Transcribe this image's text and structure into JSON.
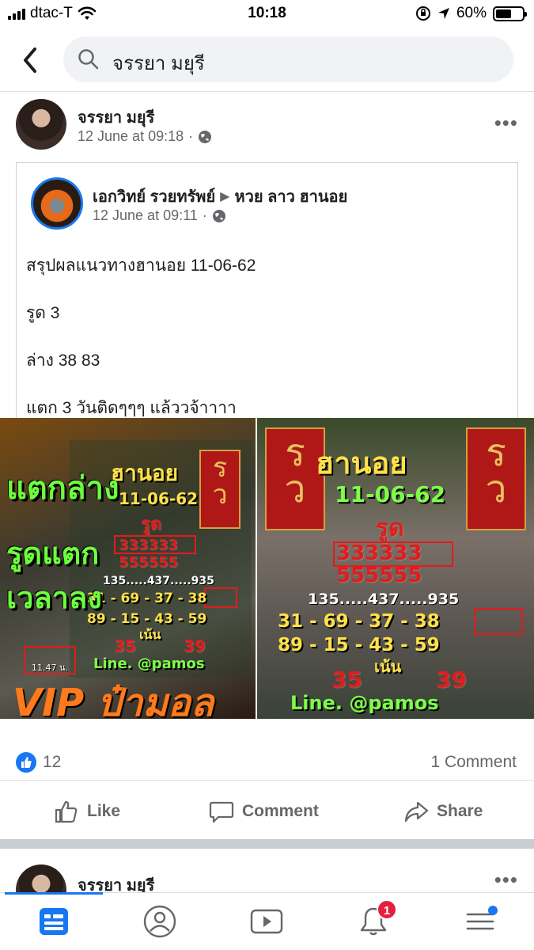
{
  "status_bar": {
    "carrier": "dtac-T",
    "time": "10:18",
    "battery_percent": "60%",
    "battery_level": 0.6
  },
  "search": {
    "query": "จรรยา มยุรี"
  },
  "post": {
    "author": "จรรยา มยุรี",
    "timestamp": "12 June at 09:18",
    "shared": {
      "page_name": "เอกวิทย์ รวยทรัพย์",
      "target_group": "หวย ลาว ฮานอย",
      "timestamp": "12 June at 09:11",
      "lines": [
        "สรุปผลแนวทางฮานอย 11-06-62",
        "รูด  3",
        "ล่าง  38  83",
        "แตก 3 วันติดๆๆๆ แล้ววจ้าาาา"
      ]
    },
    "images": {
      "left": {
        "tags": [
          "แตกล่าง",
          "รูดแตก",
          "เวลาลง"
        ],
        "time_note": "11.47 น.",
        "footer": "VIP ป๋ามอล",
        "title": "ฮานอย",
        "date": "11-06-62",
        "rood": "รูด",
        "row1": "333333",
        "row2": "555555",
        "row3": "135.....437.....935",
        "row4": "31 - 69 - 37 - 38",
        "row5": "89 - 15 - 43 - 59",
        "nen": "เน้น",
        "hl1": "35",
        "hl2": "39",
        "line_id": "Line. @pamos"
      },
      "right": {
        "title": "ฮานอย",
        "date": "11-06-62",
        "rood": "รูด",
        "row1": "333333",
        "row2": "555555",
        "row3": "135.....437.....935",
        "row4": "31 - 69 - 37 - 38",
        "row5": "89 - 15 - 43 - 59",
        "nen": "เน้น",
        "hl1": "35",
        "hl2": "39",
        "line_id": "Line. @pamos",
        "card_text": "รวย"
      }
    },
    "reactions_count": "12",
    "comments_count": "1 Comment",
    "actions": {
      "like": "Like",
      "comment": "Comment",
      "share": "Share"
    }
  },
  "next_post": {
    "author": "จรรยา มยุรี"
  },
  "tab_bar": {
    "notification_badge": "1"
  },
  "colors": {
    "accent": "#1877f2",
    "badge": "#e41e3f",
    "secondary_text": "#65676b"
  }
}
